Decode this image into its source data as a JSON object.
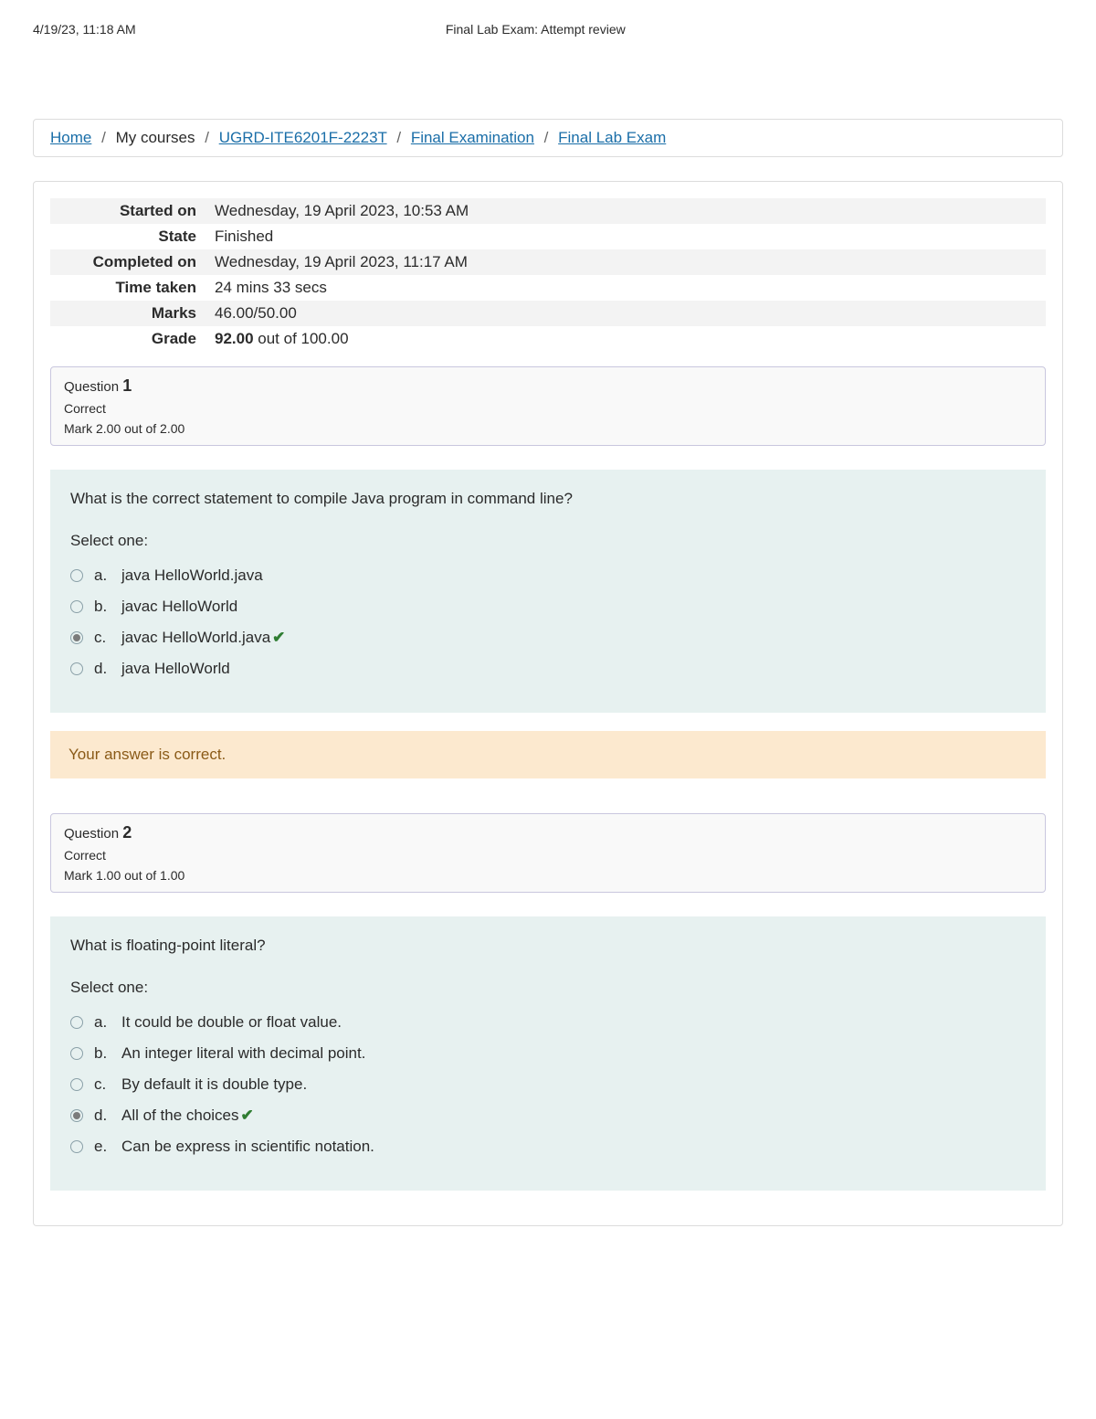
{
  "header": {
    "timestamp": "4/19/23, 11:18 AM",
    "title": "Final Lab Exam: Attempt review"
  },
  "breadcrumb": {
    "home": "Home",
    "mycourses": "My courses",
    "course": "UGRD-ITE6201F-2223T",
    "section": "Final Examination",
    "item": "Final Lab Exam"
  },
  "summary": {
    "labels": {
      "started": "Started on",
      "state": "State",
      "completed": "Completed on",
      "time": "Time taken",
      "marks": "Marks",
      "grade": "Grade"
    },
    "values": {
      "started": "Wednesday, 19 April 2023, 10:53 AM",
      "state": "Finished",
      "completed": "Wednesday, 19 April 2023, 11:17 AM",
      "time": "24 mins 33 secs",
      "marks": "46.00/50.00",
      "grade_bold": "92.00",
      "grade_rest": " out of 100.00"
    }
  },
  "labels": {
    "question": "Question ",
    "correct": "Correct",
    "selectone": "Select one:",
    "feedback_correct": "Your answer is correct."
  },
  "q1": {
    "number": "1",
    "mark": "Mark 2.00 out of 2.00",
    "text": "What is the correct statement to compile Java program in command line?",
    "opts": {
      "a": {
        "letter": "a.",
        "text": "java HelloWorld.java"
      },
      "b": {
        "letter": "b.",
        "text": "javac HelloWorld"
      },
      "c": {
        "letter": "c.",
        "text": "javac HelloWorld.java"
      },
      "d": {
        "letter": "d.",
        "text": " java HelloWorld"
      }
    }
  },
  "q2": {
    "number": "2",
    "mark": "Mark 1.00 out of 1.00",
    "text": "What is floating-point literal?",
    "opts": {
      "a": {
        "letter": "a.",
        "text": "It could be double or float value."
      },
      "b": {
        "letter": "b.",
        "text": "An integer literal with decimal point."
      },
      "c": {
        "letter": "c.",
        "text": "By default it is double type."
      },
      "d": {
        "letter": "d.",
        "text": "All of the choices"
      },
      "e": {
        "letter": "e.",
        "text": "Can be express in scientific notation."
      }
    }
  }
}
